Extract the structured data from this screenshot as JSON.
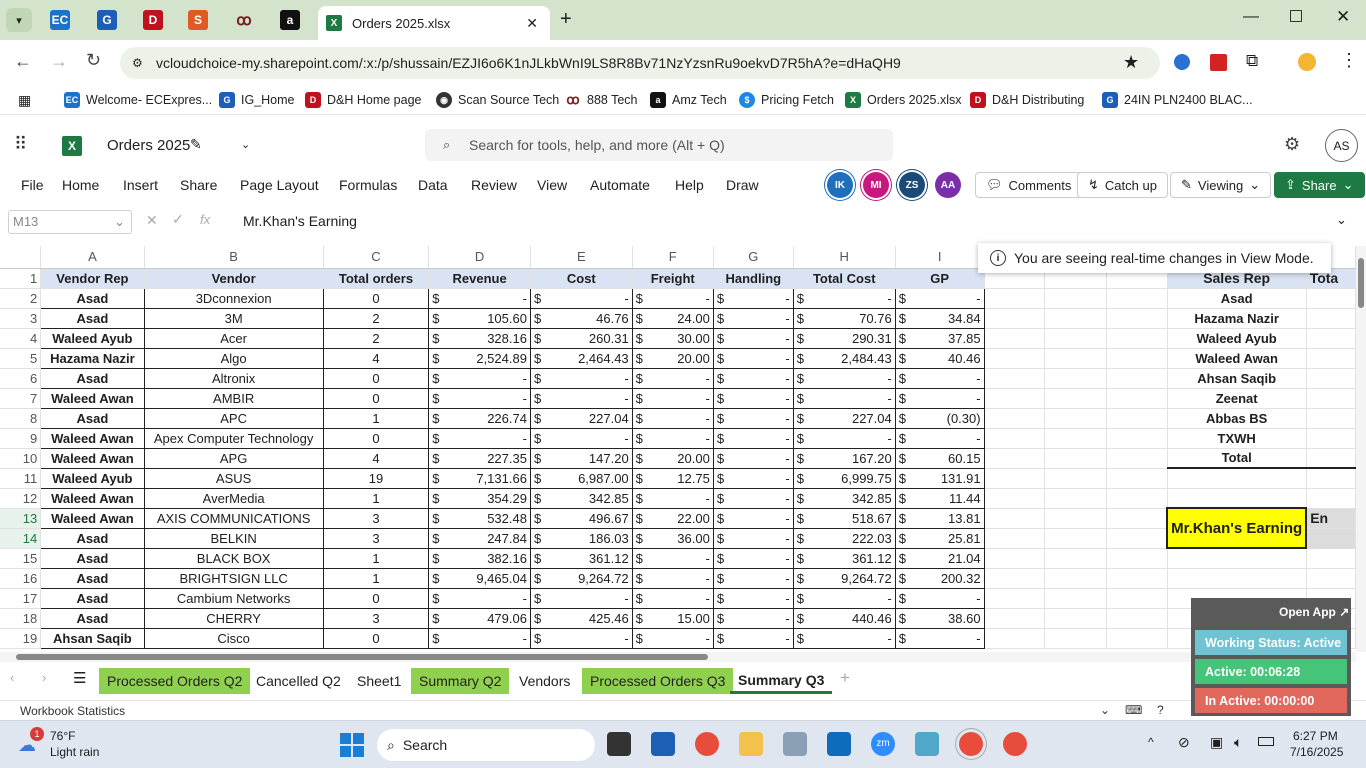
{
  "browser": {
    "active_tab_title": "Orders 2025.xlsx",
    "url": "vcloudchoice-my.sharepoint.com/:x:/p/shussain/EZJI6o6K1nJLkbWnI9LS8R8Bv71NzYzsnRu9oekvD7R5hA?e=dHaQH9",
    "bookmarks": [
      "Welcome- ECExpres...",
      "IG_Home",
      "D&H Home page",
      "Scan Source Tech",
      "888 Tech",
      "Amz Tech",
      "Pricing Fetch",
      "Orders 2025.xlsx",
      "D&H Distributing",
      "24IN PLN2400 BLAC..."
    ]
  },
  "excel": {
    "doc_title": "Orders 2025",
    "search_placeholder": "Search for tools, help, and more (Alt + Q)",
    "user_initials": "AS",
    "menus": [
      "File",
      "Home",
      "Insert",
      "Share",
      "Page Layout",
      "Formulas",
      "Data",
      "Review",
      "View",
      "Automate",
      "Help",
      "Draw"
    ],
    "collaborators": [
      {
        "initials": "IK",
        "color": "#1f6fbd"
      },
      {
        "initials": "MI",
        "color": "#c8177e"
      },
      {
        "initials": "ZS",
        "color": "#1a4a77"
      },
      {
        "initials": "AA",
        "color": "#7a2fa8"
      }
    ],
    "comments_label": "Comments",
    "catchup_label": "Catch up",
    "viewing_label": "Viewing",
    "share_label": "Share",
    "name_box": "M13",
    "formula_content": "Mr.Khan's Earning",
    "notice": "You are seeing real-time changes in View Mode."
  },
  "columns": [
    "A",
    "B",
    "C",
    "D",
    "E",
    "F",
    "G",
    "H",
    "I"
  ],
  "headers": [
    "Vendor Rep",
    "Vendor",
    "Total orders",
    "Revenue",
    "Cost",
    "Freight",
    "Handling",
    "Total Cost",
    "GP"
  ],
  "rows": [
    [
      "Asad",
      "3Dconnexion",
      "0",
      "-",
      "-",
      "-",
      "-",
      "-",
      "-"
    ],
    [
      "Asad",
      "3M",
      "2",
      "105.60",
      "46.76",
      "24.00",
      "-",
      "70.76",
      "34.84"
    ],
    [
      "Waleed Ayub",
      "Acer",
      "2",
      "328.16",
      "260.31",
      "30.00",
      "-",
      "290.31",
      "37.85"
    ],
    [
      "Hazama Nazir",
      "Algo",
      "4",
      "2,524.89",
      "2,464.43",
      "20.00",
      "-",
      "2,484.43",
      "40.46"
    ],
    [
      "Asad",
      "Altronix",
      "0",
      "-",
      "-",
      "-",
      "-",
      "-",
      "-"
    ],
    [
      "Waleed Awan",
      "AMBIR",
      "0",
      "-",
      "-",
      "-",
      "-",
      "-",
      "-"
    ],
    [
      "Asad",
      "APC",
      "1",
      "226.74",
      "227.04",
      "-",
      "-",
      "227.04",
      "(0.30)"
    ],
    [
      "Waleed Awan",
      "Apex Computer Technology",
      "0",
      "-",
      "-",
      "-",
      "-",
      "-",
      "-"
    ],
    [
      "Waleed Awan",
      "APG",
      "4",
      "227.35",
      "147.20",
      "20.00",
      "-",
      "167.20",
      "60.15"
    ],
    [
      "Waleed Ayub",
      "ASUS",
      "19",
      "7,131.66",
      "6,987.00",
      "12.75",
      "-",
      "6,999.75",
      "131.91"
    ],
    [
      "Waleed Awan",
      "AverMedia",
      "1",
      "354.29",
      "342.85",
      "-",
      "-",
      "342.85",
      "11.44"
    ],
    [
      "Waleed Awan",
      "AXIS COMMUNICATIONS",
      "3",
      "532.48",
      "496.67",
      "22.00",
      "-",
      "518.67",
      "13.81"
    ],
    [
      "Asad",
      "BELKIN",
      "3",
      "247.84",
      "186.03",
      "36.00",
      "-",
      "222.03",
      "25.81"
    ],
    [
      "Asad",
      "BLACK BOX",
      "1",
      "382.16",
      "361.12",
      "-",
      "-",
      "361.12",
      "21.04"
    ],
    [
      "Asad",
      "BRIGHTSIGN LLC",
      "1",
      "9,465.04",
      "9,264.72",
      "-",
      "-",
      "9,264.72",
      "200.32"
    ],
    [
      "Asad",
      "Cambium Networks",
      "0",
      "-",
      "-",
      "-",
      "-",
      "-",
      "-"
    ],
    [
      "Asad",
      "CHERRY",
      "3",
      "479.06",
      "425.46",
      "15.00",
      "-",
      "440.46",
      "38.60"
    ],
    [
      "Ahsan Saqib",
      "Cisco",
      "0",
      "-",
      "-",
      "-",
      "-",
      "-",
      "-"
    ]
  ],
  "currency": "$",
  "side_table": {
    "header": "Sales Rep",
    "header2": "Tota",
    "reps": [
      "Asad",
      "Hazama Nazir",
      "Waleed Ayub",
      "Waleed Awan",
      "Ahsan Saqib",
      "Zeenat",
      "Abbas BS",
      "TXWH",
      "Total"
    ],
    "earning_label": "Mr.Khan's Earning",
    "earning_cut": "En"
  },
  "sheet_tabs": [
    {
      "label": "Processed Orders Q2",
      "green": true
    },
    {
      "label": "Cancelled Q2",
      "green": false
    },
    {
      "label": "Sheet1",
      "green": false
    },
    {
      "label": "Summary Q2",
      "green": true
    },
    {
      "label": "Vendors",
      "green": false
    },
    {
      "label": "Processed Orders Q3",
      "green": true
    },
    {
      "label": "Summary Q3",
      "green": false,
      "active": true
    }
  ],
  "status_left": "Workbook Statistics",
  "widget": {
    "open_app": "Open App ↗",
    "working": "Working Status: Active",
    "active": "Active: 00:06:28",
    "inactive": "In Active: 00:00:00"
  },
  "taskbar": {
    "weather_temp": "76°F",
    "weather_desc": "Light rain",
    "weather_badge": "1",
    "search": "Search",
    "time": "6:27 PM",
    "date": "7/16/2025"
  }
}
